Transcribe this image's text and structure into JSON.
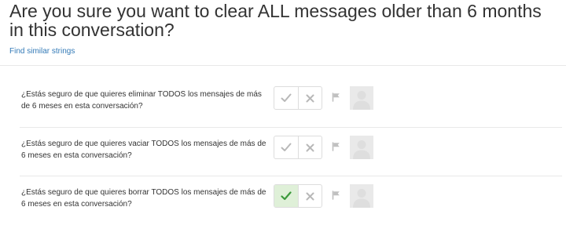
{
  "source": {
    "text": "Are you sure you want to clear ALL messages older than 6 months in this conversation?",
    "similar_link": "Find similar strings"
  },
  "suggestions": [
    {
      "text": "¿Estás seguro de que quieres eliminar TODOS los mensajes de más de 6 meses en esta conversación?",
      "approved": false,
      "icons": [
        "check-icon",
        "x-icon",
        "flag-icon",
        "user-avatar-icon"
      ]
    },
    {
      "text": "¿Estás seguro de que quieres vaciar TODOS los mensajes de más de 6 meses en esta conversación?",
      "approved": false,
      "icons": [
        "check-icon",
        "x-icon",
        "flag-icon",
        "user-avatar-icon"
      ]
    },
    {
      "text": "¿Estás seguro de que quieres borrar TODOS los mensajes de más de 6 meses en esta conversación?",
      "approved": true,
      "icons": [
        "check-icon",
        "x-icon",
        "flag-icon",
        "user-avatar-icon"
      ]
    }
  ],
  "colors": {
    "link": "#337ab7",
    "approved_background": "#dff0d8",
    "approved_check": "#3c9a3c",
    "inactive_icon": "#b8b8b8",
    "avatar_background": "#e9e9e9"
  }
}
